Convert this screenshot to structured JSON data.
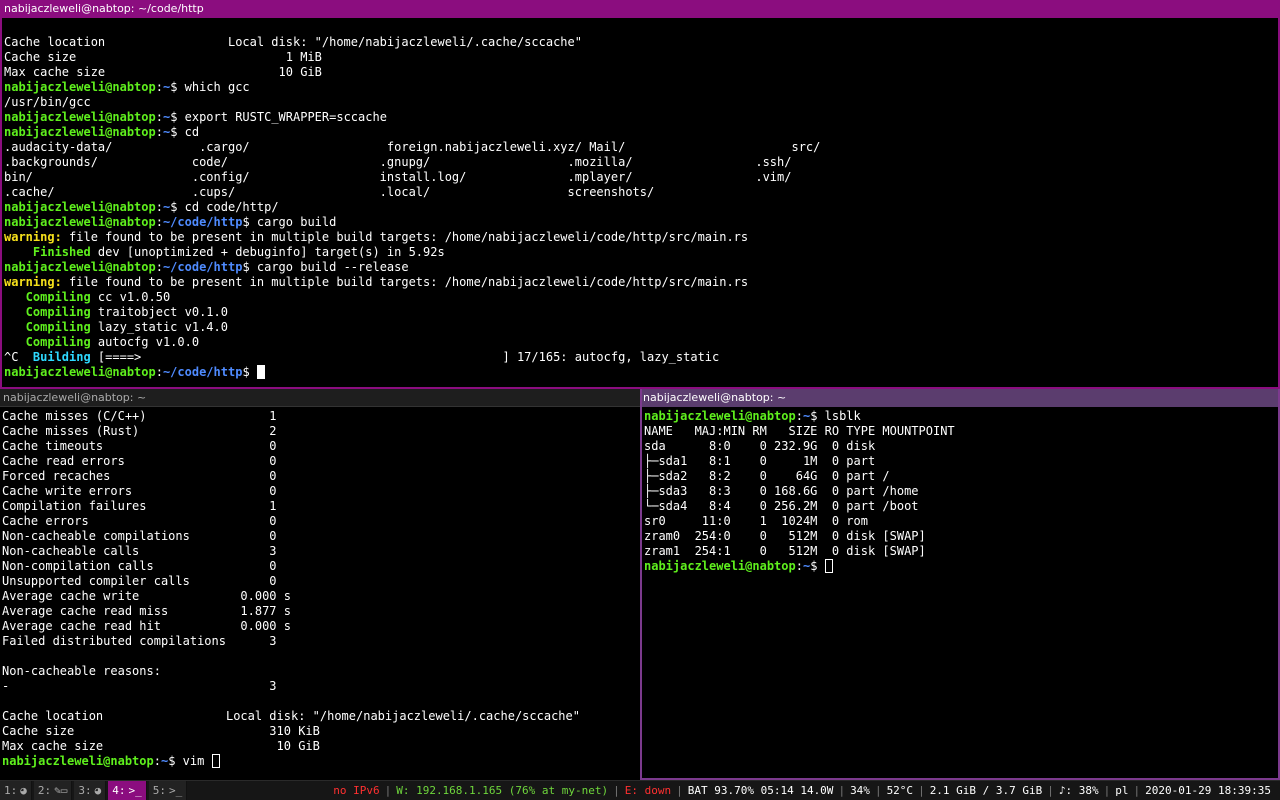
{
  "top_pane": {
    "title": "nabijaczleweli@nabtop: ~/code/http",
    "lines": [
      [
        {
          "t": "Cache location                 Local disk: \"/home/nabijaczleweli/.cache/sccache\""
        }
      ],
      [
        {
          "t": "Cache size                             1 MiB"
        }
      ],
      [
        {
          "t": "Max cache size                        10 GiB"
        }
      ],
      [
        {
          "c": "p-user",
          "t": "nabijaczleweli@nabtop"
        },
        {
          "t": ":"
        },
        {
          "c": "p-path",
          "t": "~"
        },
        {
          "t": "$ which gcc"
        }
      ],
      [
        {
          "t": "/usr/bin/gcc"
        }
      ],
      [
        {
          "c": "p-user",
          "t": "nabijaczleweli@nabtop"
        },
        {
          "t": ":"
        },
        {
          "c": "p-path",
          "t": "~"
        },
        {
          "t": "$ export RUSTC_WRAPPER=sccache"
        }
      ],
      [
        {
          "c": "p-user",
          "t": "nabijaczleweli@nabtop"
        },
        {
          "t": ":"
        },
        {
          "c": "p-path",
          "t": "~"
        },
        {
          "t": "$ cd"
        }
      ],
      [
        {
          "t": ".audacity-data/            .cargo/                   foreign.nabijaczleweli.xyz/ Mail/                       src/"
        }
      ],
      [
        {
          "t": ".backgrounds/             code/                     .gnupg/                   .mozilla/                 .ssh/"
        }
      ],
      [
        {
          "t": "bin/                      .config/                  install.log/              .mplayer/                 .vim/"
        }
      ],
      [
        {
          "t": ".cache/                   .cups/                    .local/                   screenshots/"
        }
      ],
      [
        {
          "c": "p-user",
          "t": "nabijaczleweli@nabtop"
        },
        {
          "t": ":"
        },
        {
          "c": "p-path",
          "t": "~"
        },
        {
          "t": "$ cd code/http/"
        }
      ],
      [
        {
          "c": "p-user",
          "t": "nabijaczleweli@nabtop"
        },
        {
          "t": ":"
        },
        {
          "c": "p-path",
          "t": "~/code/http"
        },
        {
          "t": "$ cargo build"
        }
      ],
      [
        {
          "c": "warn",
          "t": "warning:"
        },
        {
          "t": " file found to be present in multiple build targets: /home/nabijaczleweli/code/http/src/main.rs"
        }
      ],
      [
        {
          "c": "green",
          "t": "    Finished"
        },
        {
          "t": " dev [unoptimized + debuginfo] target(s) in 5.92s"
        }
      ],
      [
        {
          "c": "p-user",
          "t": "nabijaczleweli@nabtop"
        },
        {
          "t": ":"
        },
        {
          "c": "p-path",
          "t": "~/code/http"
        },
        {
          "t": "$ cargo build --release"
        }
      ],
      [
        {
          "c": "warn",
          "t": "warning:"
        },
        {
          "t": " file found to be present in multiple build targets: /home/nabijaczleweli/code/http/src/main.rs"
        }
      ],
      [
        {
          "c": "green",
          "t": "   Compiling"
        },
        {
          "t": " cc v1.0.50"
        }
      ],
      [
        {
          "c": "green",
          "t": "   Compiling"
        },
        {
          "t": " traitobject v0.1.0"
        }
      ],
      [
        {
          "c": "green",
          "t": "   Compiling"
        },
        {
          "t": " lazy_static v1.4.0"
        }
      ],
      [
        {
          "c": "green",
          "t": "   Compiling"
        },
        {
          "t": " autocfg v1.0.0"
        }
      ],
      [
        {
          "t": "^C  "
        },
        {
          "c": "cyan",
          "t": "Building"
        },
        {
          "t": " [====>                                                  ] 17/165: autocfg, lazy_static"
        }
      ],
      [
        {
          "c": "p-user",
          "t": "nabijaczleweli@nabtop"
        },
        {
          "t": ":"
        },
        {
          "c": "p-path",
          "t": "~/code/http"
        },
        {
          "t": "$ "
        },
        {
          "cursor": "solid"
        }
      ]
    ]
  },
  "bottom_left_pane": {
    "title": "nabijaczleweli@nabtop: ~",
    "lines": [
      [
        {
          "t": "Cache misses (C/C++)                 1"
        }
      ],
      [
        {
          "t": "Cache misses (Rust)                  2"
        }
      ],
      [
        {
          "t": "Cache timeouts                       0"
        }
      ],
      [
        {
          "t": "Cache read errors                    0"
        }
      ],
      [
        {
          "t": "Forced recaches                      0"
        }
      ],
      [
        {
          "t": "Cache write errors                   0"
        }
      ],
      [
        {
          "t": "Compilation failures                 1"
        }
      ],
      [
        {
          "t": "Cache errors                         0"
        }
      ],
      [
        {
          "t": "Non-cacheable compilations           0"
        }
      ],
      [
        {
          "t": "Non-cacheable calls                  3"
        }
      ],
      [
        {
          "t": "Non-compilation calls                0"
        }
      ],
      [
        {
          "t": "Unsupported compiler calls           0"
        }
      ],
      [
        {
          "t": "Average cache write              0.000 s"
        }
      ],
      [
        {
          "t": "Average cache read miss          1.877 s"
        }
      ],
      [
        {
          "t": "Average cache read hit           0.000 s"
        }
      ],
      [
        {
          "t": "Failed distributed compilations      3"
        }
      ],
      [
        {
          "t": ""
        }
      ],
      [
        {
          "t": "Non-cacheable reasons:"
        }
      ],
      [
        {
          "t": "-                                    3"
        }
      ],
      [
        {
          "t": ""
        }
      ],
      [
        {
          "t": "Cache location                 Local disk: \"/home/nabijaczleweli/.cache/sccache\""
        }
      ],
      [
        {
          "t": "Cache size                           310 KiB"
        }
      ],
      [
        {
          "t": "Max cache size                        10 GiB"
        }
      ],
      [
        {
          "c": "p-user",
          "t": "nabijaczleweli@nabtop"
        },
        {
          "t": ":"
        },
        {
          "c": "p-path",
          "t": "~"
        },
        {
          "t": "$ vim "
        },
        {
          "cursor": "hollow"
        }
      ]
    ]
  },
  "bottom_right_pane": {
    "title": "nabijaczleweli@nabtop: ~",
    "lines": [
      [
        {
          "c": "p-user",
          "t": "nabijaczleweli@nabtop"
        },
        {
          "t": ":"
        },
        {
          "c": "p-path",
          "t": "~"
        },
        {
          "t": "$ lsblk"
        }
      ],
      [
        {
          "t": "NAME   MAJ:MIN RM   SIZE RO TYPE MOUNTPOINT"
        }
      ],
      [
        {
          "t": "sda      8:0    0 232.9G  0 disk"
        }
      ],
      [
        {
          "t": "├─sda1   8:1    0     1M  0 part"
        }
      ],
      [
        {
          "t": "├─sda2   8:2    0    64G  0 part /"
        }
      ],
      [
        {
          "t": "├─sda3   8:3    0 168.6G  0 part /home"
        }
      ],
      [
        {
          "t": "└─sda4   8:4    0 256.2M  0 part /boot"
        }
      ],
      [
        {
          "t": "sr0     11:0    1  1024M  0 rom"
        }
      ],
      [
        {
          "t": "zram0  254:0    0   512M  0 disk [SWAP]"
        }
      ],
      [
        {
          "t": "zram1  254:1    0   512M  0 disk [SWAP]"
        }
      ],
      [
        {
          "c": "p-user",
          "t": "nabijaczleweli@nabtop"
        },
        {
          "t": ":"
        },
        {
          "c": "p-path",
          "t": "~"
        },
        {
          "t": "$ "
        },
        {
          "cursor": "hollow"
        }
      ]
    ]
  },
  "workspaces": [
    {
      "num": "1:",
      "icon": "◕",
      "icon_name": "firefox-icon",
      "active": false
    },
    {
      "num": "2:",
      "icon": "✎▭",
      "icon_name": "editor-icon",
      "active": false
    },
    {
      "num": "3:",
      "icon": "◕",
      "icon_name": "firefox-icon",
      "active": false
    },
    {
      "num": "4:",
      "icon": ">_",
      "icon_name": "terminal-icon",
      "active": true
    },
    {
      "num": "5:",
      "icon": ">_",
      "icon_name": "terminal-icon",
      "active": false
    }
  ],
  "status": {
    "ipv6": "no IPv6",
    "wifi": "W: 192.168.1.165 (76% at my-net)",
    "ethernet": "E: down",
    "battery": "BAT 93.70% 05:14 14.0W",
    "cpu": "34%",
    "temperature": "52°C",
    "memory": "2.1 GiB / 3.7 GiB",
    "volume": "♪: 38%",
    "keyboard": "pl",
    "datetime": "2020-01-29 18:39:35"
  },
  "colors": {
    "active_border": "#8b0d7f",
    "prompt_user": "#5ff01d",
    "prompt_path": "#4f8bff",
    "warning": "#f6e11b",
    "status_red": "#ff3030",
    "status_green": "#6fd63c"
  }
}
